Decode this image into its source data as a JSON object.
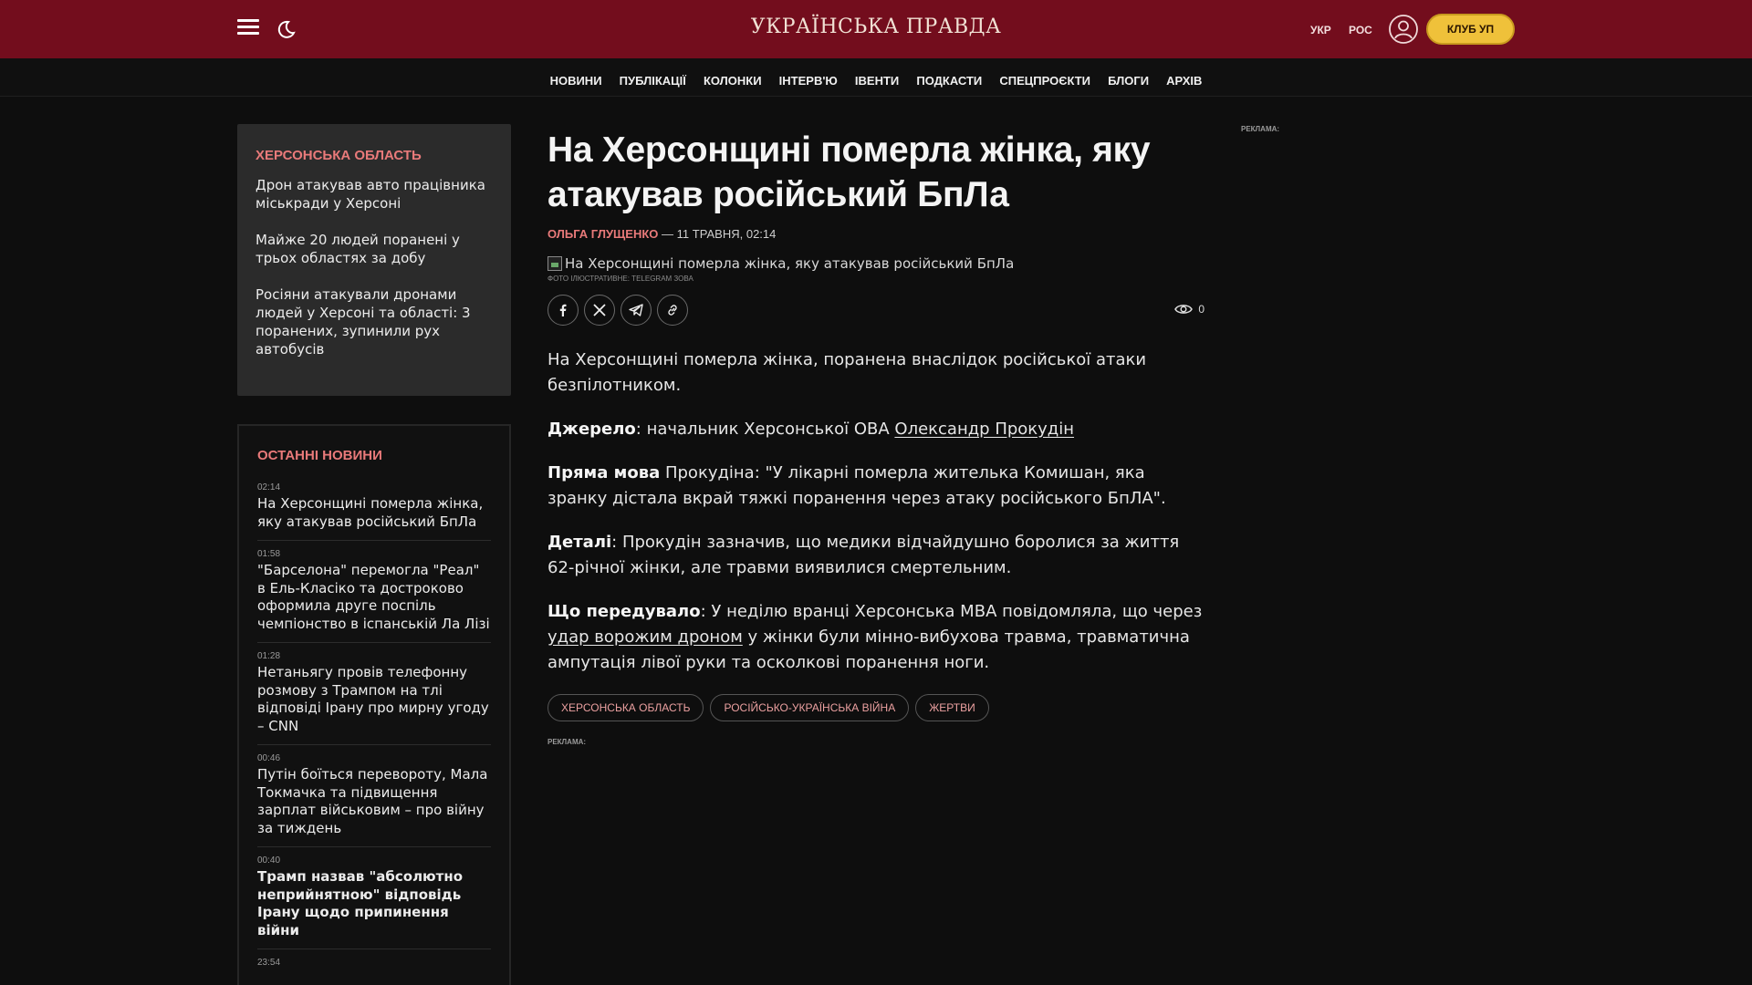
{
  "header": {
    "logo": "УКРАЇНСЬКА ПРАВДА",
    "lang_ukr": "УКР",
    "lang_ros": "РОС",
    "club_button": "КЛУБ УП",
    "menu_icon": "menu-icon",
    "theme_icon": "moon-icon",
    "user_icon": "user-icon"
  },
  "nav": {
    "items": [
      "НОВИНИ",
      "ПУБЛІКАЦІЇ",
      "КОЛОНКИ",
      "ІНТЕРВ'Ю",
      "ІВЕНТИ",
      "ПОДКАСТИ",
      "СПЕЦПРОЄКТИ",
      "БЛОГИ",
      "АРХІВ"
    ]
  },
  "region": {
    "title": "ХЕРСОНСЬКА ОБЛАСТЬ",
    "items": [
      "Дрон атакував авто працівника міськради у Херсоні",
      "Майже 20 людей поранені у трьох областях за добу",
      "Росіяни атакували дронами людей у Херсоні та області: 3 поранених, зупинили рух автобусів"
    ]
  },
  "latest": {
    "title": "ОСТАННІ НОВИНИ",
    "items": [
      {
        "time": "02:14",
        "title": "На Херсонщині померла жінка, яку атакував російський БпЛа"
      },
      {
        "time": "01:58",
        "title": "\"Барселона\" перемогла \"Реал\" в Ель-Класіко та достроково оформила друге поспіль чемпіонство в іспанській Ла Лізі"
      },
      {
        "time": "01:28",
        "title": "Нетаньягу провів телефонну розмову з Трампом на тлі відповіді Ірану про мирну угоду – CNN"
      },
      {
        "time": "00:46",
        "title": "Путін боїться перевороту, Мала Токмачка та підвищення зарплат військовим – про війну за тиждень"
      },
      {
        "time": "00:40",
        "title": "Трамп назвав \"абсолютно неприйнятною\" відповідь Ірану щодо припинення війни"
      },
      {
        "time": "23:54",
        "title": ""
      }
    ]
  },
  "article": {
    "headline": "На Херсонщині померла жінка, яку атакував російський БпЛа",
    "author": "ОЛЬГА ГЛУЩЕНКО",
    "date": " — 11 ТРАВНЯ, 02:14",
    "image_alt": "На Херсонщині померла жінка, яку атакував російський БпЛа",
    "image_caption": "ФОТО ІЛЮСТРАТИВНЕ: TELEGRAM ЗОВА",
    "views": "0",
    "p1": "На Херсонщині померла жінка, поранена внаслідок російської атаки безпілотником.",
    "p2_label": "Джерело",
    "p2_text": ": начальник Херсонської ОВА ",
    "p2_link": "Олександр Прокудін",
    "p3_label": "Пряма мова",
    "p3_text": " Прокудіна: \"У лікарні померла жителька Комишан, яка зранку дістала вкрай тяжкі поранення через атаку російського БпЛА\".",
    "p4_label": "Деталі",
    "p4_text": ": Прокудін зазначив, що медики відчайдушно боролися за життя 62-річної жінки, але травми виявилися смертельним.",
    "p5_label": "Що передувало",
    "p5_text": ": У неділю вранці Херсонська МВА повідомляла, що через ",
    "p5_link": "удар ворожим дроном",
    "p5_text2": " у жінки були мінно-вибухова травма, травматична ампутація лівої руки та осколкові поранення ноги.",
    "tags": [
      "ХЕРСОНСЬКА ОБЛАСТЬ",
      "РОСІЙСЬКО-УКРАЇНСЬКА ВІЙНА",
      "ЖЕРТВИ"
    ],
    "ad_label": "РЕКЛАМА:"
  },
  "sidebar_right": {
    "ad_label": "РЕКЛАМА:"
  },
  "colors": {
    "header_bg": "#730d1d",
    "accent": "#e97a7a",
    "club_button": "#efc13a",
    "page_bg": "#0e0e0e"
  }
}
